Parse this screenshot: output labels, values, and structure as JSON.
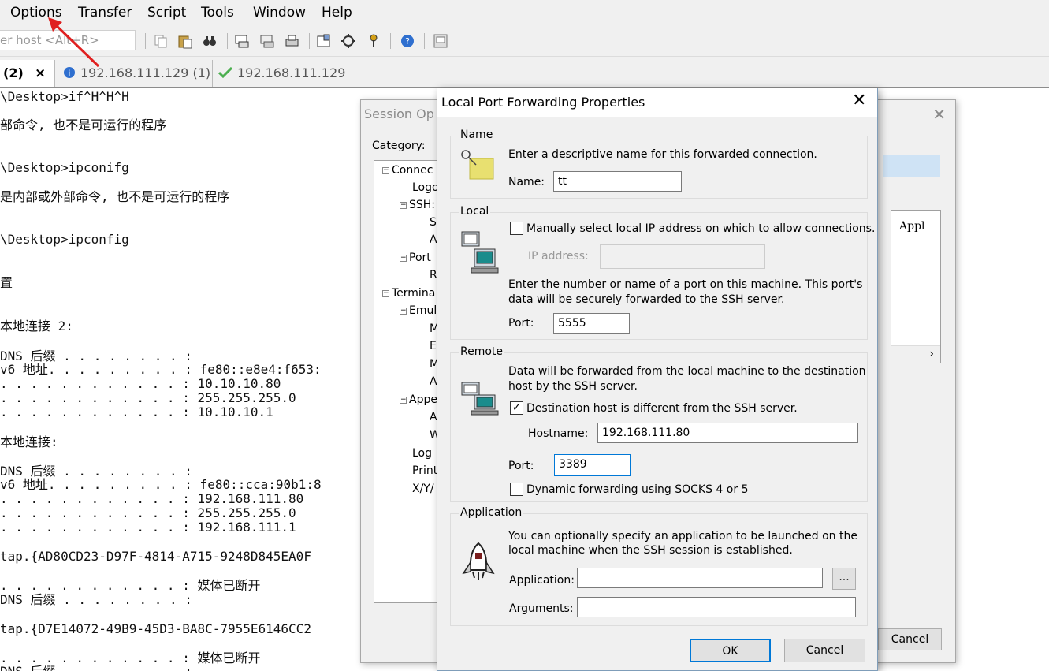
{
  "menubar": {
    "items": [
      "Options",
      "Transfer",
      "Script",
      "Tools",
      "Window",
      "Help"
    ]
  },
  "toolbar": {
    "quick_connect_placeholder": "er host <Alt+R>"
  },
  "tabs": {
    "active_label": "(2)",
    "close_label": "×",
    "tab2_label": "192.168.111.129 (1)",
    "tab3_label": "192.168.111.129"
  },
  "terminal": {
    "lines": [
      "\\Desktop>if^H^H^H",
      "部命令, 也不是可运行的程序",
      "",
      "\\Desktop>ipconifg",
      "是内部或外部命令, 也不是可运行的程序",
      "",
      "\\Desktop>ipconfig",
      "",
      "置",
      "",
      "本地连接 2:",
      "",
      "DNS 后缀 . . . . . . . . :",
      "v6 地址. . . . . . . . . : fe80::e8e4:f653:",
      ". . . . . . . . . . . . : 10.10.10.80",
      ". . . . . . . . . . . . : 255.255.255.0",
      ". . . . . . . . . . . . : 10.10.10.1",
      "",
      "本地连接:",
      "",
      "DNS 后缀 . . . . . . . . :",
      "v6 地址. . . . . . . . . : fe80::cca:90b1:8",
      ". . . . . . . . . . . . : 192.168.111.80",
      ". . . . . . . . . . . . : 255.255.255.0",
      ". . . . . . . . . . . . : 192.168.111.1",
      "",
      "tap.{AD80CD23-D97F-4814-A715-9248D845EA0F",
      "",
      ". . . . . . . . . . . . : 媒体已断开",
      "DNS 后缀 . . . . . . . . :",
      "",
      "tap.{D7E14072-49B9-45D3-BA8C-7955E6146CC2",
      "",
      ". . . . . . . . . . . . : 媒体已断开",
      "DNS 后缀 . . . . . . . . :"
    ]
  },
  "session_options": {
    "title": "Session Op",
    "category_label": "Category:",
    "tree": [
      "Connec",
      "Logo",
      "SSH:",
      "S",
      "A",
      "Port",
      "R",
      "Termina",
      "Emul",
      "M",
      "E",
      "M",
      "A",
      "Appe",
      "A",
      "W",
      "Log",
      "Print",
      "X/Y/"
    ],
    "list_column": "Appl",
    "cancel_label": "Cancel"
  },
  "lpf": {
    "title": "Local Port Forwarding Properties",
    "name_group": {
      "title": "Name",
      "description": "Enter a descriptive name for this forwarded connection.",
      "name_label": "Name:",
      "name_value": "tt"
    },
    "local_group": {
      "title": "Local",
      "manual_ip_label": "Manually select local IP address on which to allow connections.",
      "manual_ip_checked": false,
      "ip_label": "IP address:",
      "ip_value": "",
      "port_desc_1": "Enter the number or name of a port on this machine.  This port's",
      "port_desc_2": "data will be securely forwarded to the SSH server.",
      "port_label": "Port:",
      "port_value": "5555"
    },
    "remote_group": {
      "title": "Remote",
      "desc_1": "Data will be forwarded from the local machine to the destination",
      "desc_2": "host by the SSH server.",
      "dest_diff_label": "Destination host is different from the SSH server.",
      "dest_diff_checked": true,
      "hostname_label": "Hostname:",
      "hostname_value": "192.168.111.80",
      "port_label": "Port:",
      "port_value": "3389",
      "socks_label": "Dynamic forwarding using SOCKS 4 or 5",
      "socks_checked": false
    },
    "application_group": {
      "title": "Application",
      "desc_1": "You can optionally specify an application to be launched on the",
      "desc_2": "local machine when the SSH session is established.",
      "application_label": "Application:",
      "application_value": "",
      "browse_label": "...",
      "arguments_label": "Arguments:",
      "arguments_value": ""
    },
    "ok_label": "OK",
    "cancel_label": "Cancel"
  },
  "colors": {
    "accent": "#0078d7",
    "dialog_bg": "#f0f0f0",
    "arrow": "#e02020"
  }
}
